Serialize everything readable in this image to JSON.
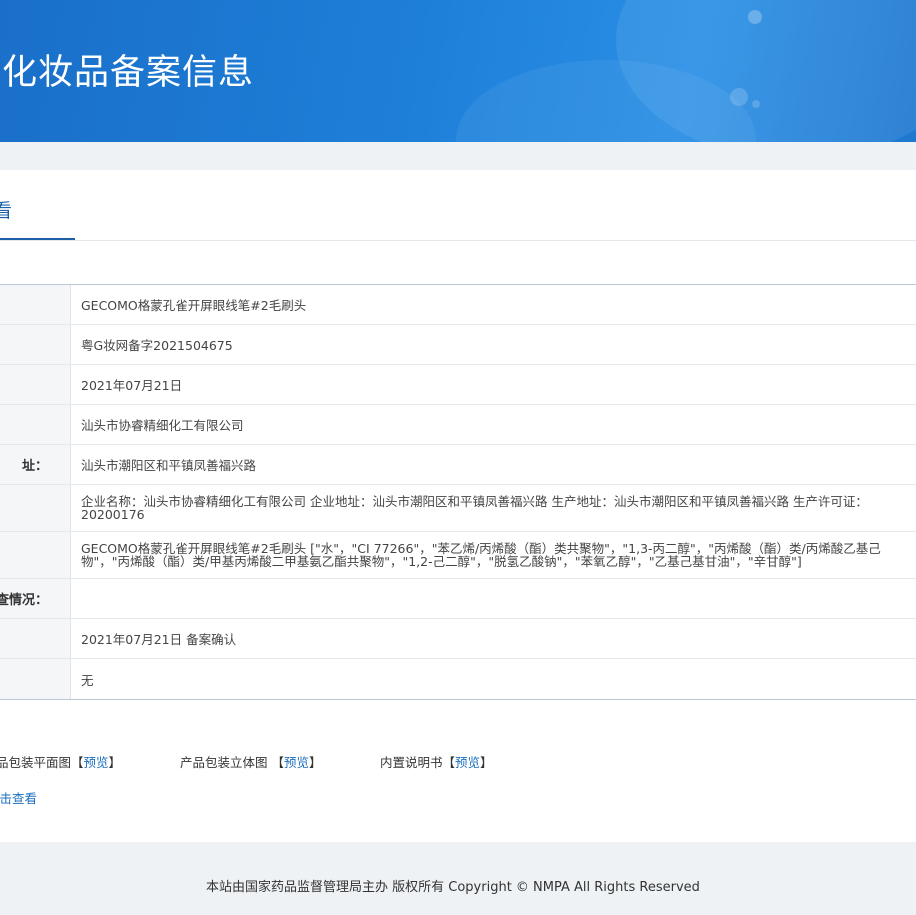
{
  "banner": {
    "title": "通化妆品备案信息"
  },
  "tabs": {
    "active_label": "查看"
  },
  "info": {
    "rows": [
      {
        "label": "",
        "value": "GECOMO格蒙孔雀开屏眼线笔#2毛刷头"
      },
      {
        "label": "",
        "value": "粤G妆网备字2021504675"
      },
      {
        "label": "",
        "value": "2021年07月21日"
      },
      {
        "label": "",
        "value": "汕头市协睿精细化工有限公司"
      },
      {
        "label": "址：",
        "value": "汕头市潮阳区和平镇凤善福兴路"
      },
      {
        "label": "",
        "value_line1": "企业名称：汕头市协睿精细化工有限公司 企业地址：汕头市潮阳区和平镇凤善福兴路 生产地址：汕头市潮阳区和平镇凤善福兴路 生产许可证：",
        "value_line2": "20200176"
      },
      {
        "label": "",
        "value_line1": "GECOMO格蒙孔雀开屏眼线笔#2毛刷头 [\"水\"，\"CI 77266\"，\"苯乙烯/丙烯酸（酯）类共聚物\"，\"1,3-丙二醇\"，\"丙烯酸（酯）类/丙烯酸乙基己",
        "value_line2": "物\"，\"丙烯酸（酯）类/甲基丙烯酸二甲基氨乙酯共聚物\"，\"1,2-己二醇\"，\"脱氢乙酸钠\"，\"苯氧乙醇\"，\"乙基己基甘油\"，\"辛甘醇\"]"
      },
      {
        "label": "查情况：",
        "value": ""
      },
      {
        "label": "",
        "value": "2021年07月21日 备案确认"
      },
      {
        "label": "",
        "value": "无"
      }
    ]
  },
  "attachments": {
    "item1_label": "品包装平面图",
    "item2_label": "产品包装立体图 ",
    "item3_label": "内置说明书",
    "bracket_open": "【",
    "bracket_close": "】",
    "preview_label": "预览",
    "more_label": "点击查看"
  },
  "footer": {
    "text": "本站由国家药品监督管理局主办 版权所有 Copyright © NMPA All Rights Reserved"
  }
}
